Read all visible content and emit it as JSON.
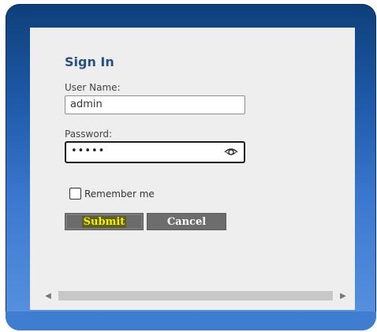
{
  "form": {
    "title": "Sign In",
    "username_label": "User Name:",
    "username_value": "admin",
    "password_label": "Password:",
    "password_value_masked": "•••••",
    "remember_label": "Remember me",
    "remember_checked": false,
    "submit_label": "Submit",
    "cancel_label": "Cancel"
  },
  "icons": {
    "password_toggle": "eye-icon",
    "scroll_left": "chevron-left-icon",
    "scroll_right": "chevron-right-icon"
  },
  "colors": {
    "title": "#2a4f86",
    "frame": "#1e5aa8",
    "submit_text": "#f5f000",
    "button_bg": "#6d6d6d"
  }
}
